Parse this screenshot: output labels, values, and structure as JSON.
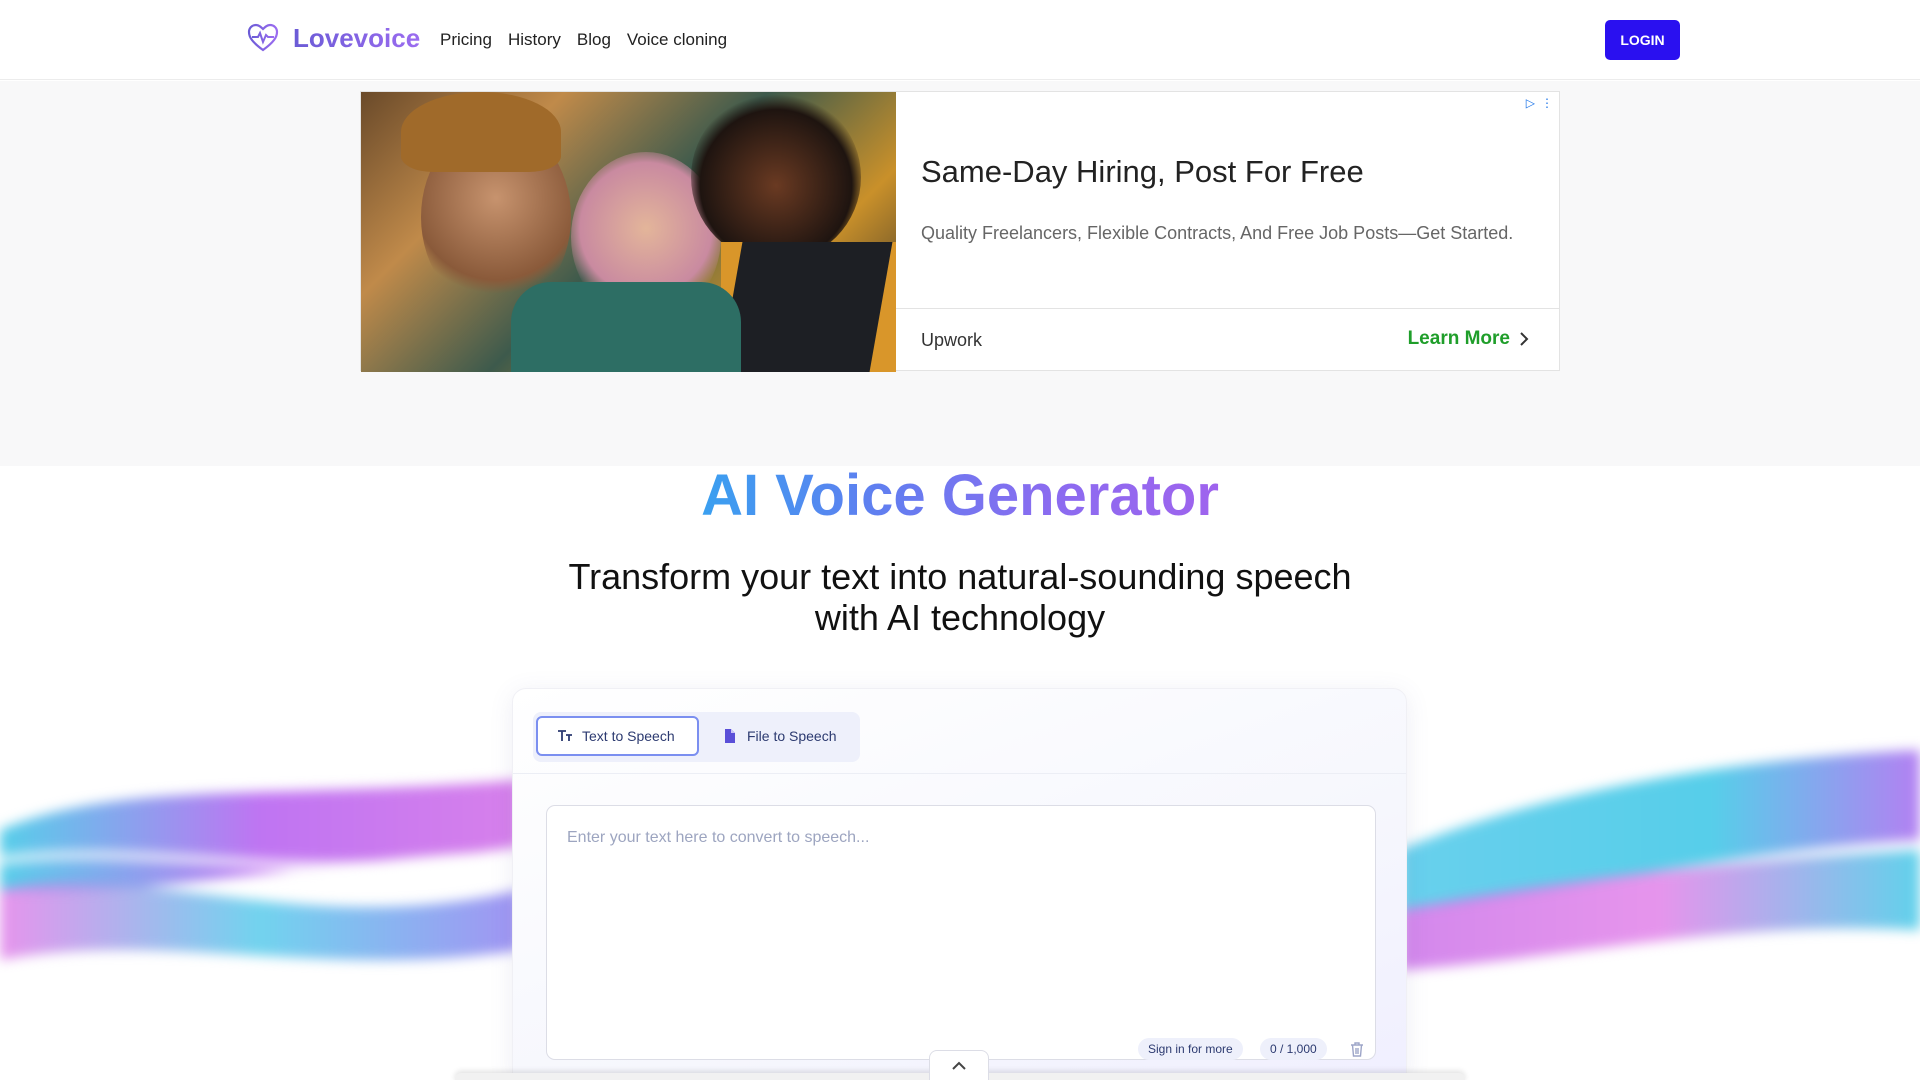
{
  "nav": {
    "logo_text": "Lovevoice",
    "links": [
      "Pricing",
      "History",
      "Blog",
      "Voice cloning"
    ],
    "login_label": "LOGIN",
    "logo_icon": "heart-pulse-icon"
  },
  "ad": {
    "title": "Same-Day Hiring, Post For Free",
    "description": "Quality Freelancers, Flexible Contracts, And Free Job Posts—Get Started.",
    "brand": "Upwork",
    "cta": "Learn More",
    "cta_color": "#1f9e2a"
  },
  "hero": {
    "title": "AI Voice Generator",
    "subtitle": "Transform your text into natural-sounding speech with AI technology"
  },
  "converter": {
    "tabs": [
      {
        "label": "Text to Speech",
        "icon": "text-icon",
        "active": true
      },
      {
        "label": "File to Speech",
        "icon": "file-icon",
        "active": false
      }
    ],
    "placeholder": "Enter your text here to convert to speech...",
    "value": "",
    "sign_in_label": "Sign in for more",
    "char_count": "0 / 1,000"
  },
  "colors": {
    "accent": "#2a10f0",
    "brand_purple": "#7b61e8"
  }
}
